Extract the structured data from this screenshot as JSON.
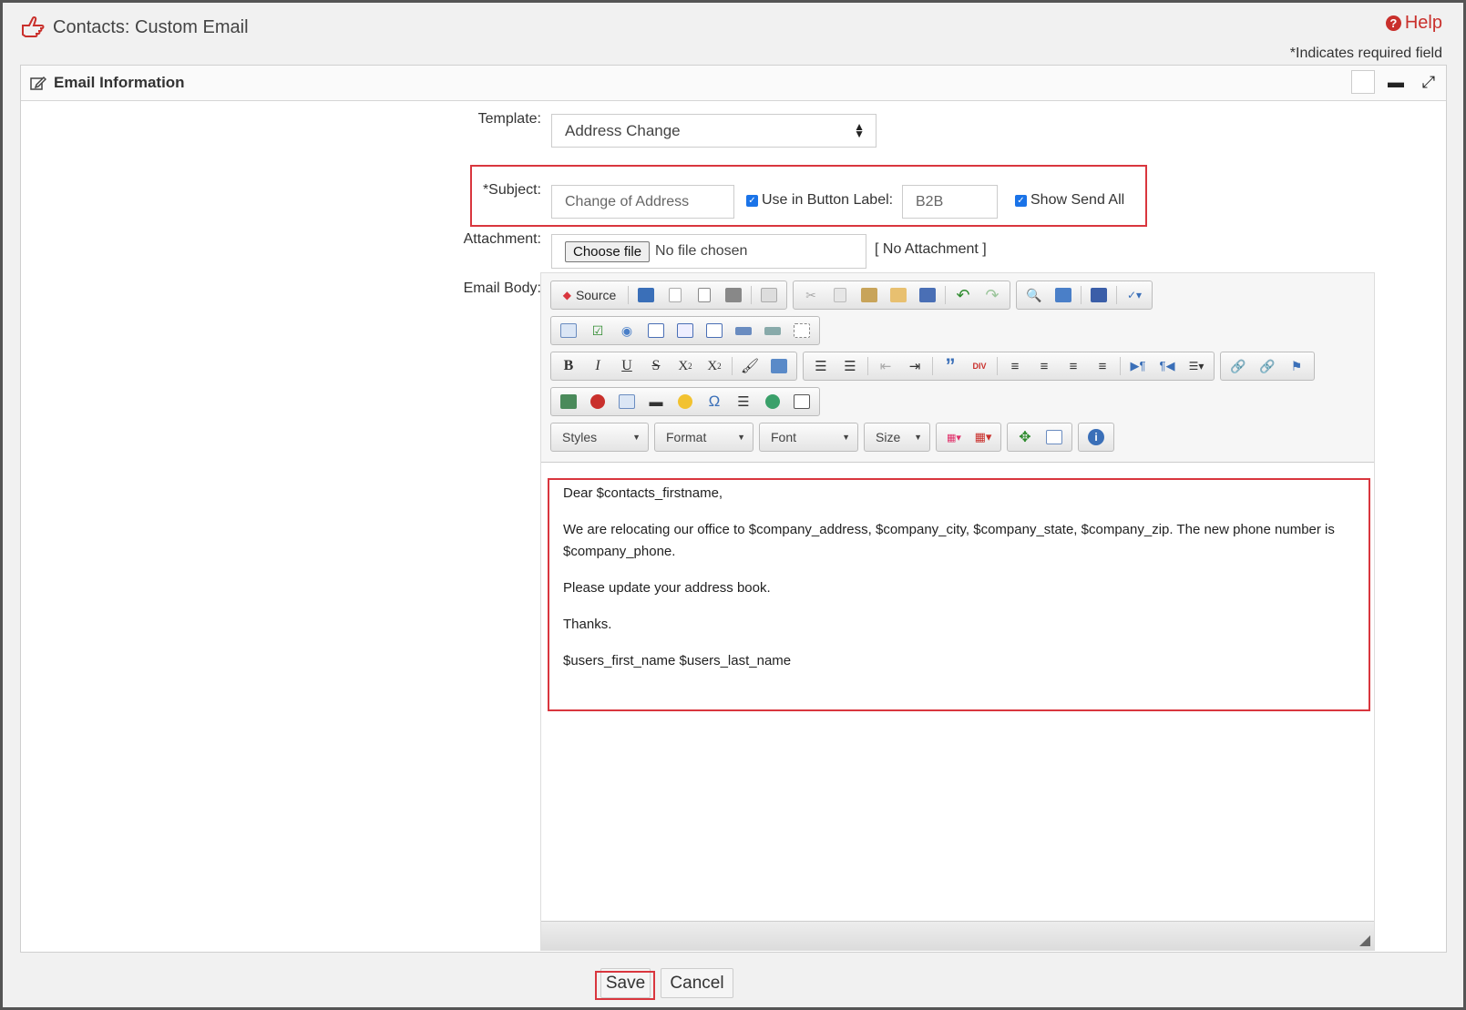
{
  "header": {
    "title": "Contacts: Custom Email",
    "help_label": "Help",
    "required_note": "*Indicates required field"
  },
  "panel": {
    "title": "Email Information"
  },
  "form": {
    "template_label": "Template:",
    "template_value": "Address Change",
    "subject_label": "*Subject:",
    "subject_value": "Change of Address",
    "use_in_button_label": "Use in Button Label:",
    "button_label_value": "B2B",
    "show_send_all_label": "Show Send All",
    "attachment_label": "Attachment:",
    "choose_file_label": "Choose file",
    "no_file_text": "No file chosen",
    "no_attachment_text": "[ No Attachment ]",
    "email_body_label": "Email Body:"
  },
  "editor": {
    "source_label": "Source",
    "combos": [
      "Styles",
      "Format",
      "Font",
      "Size"
    ],
    "body": [
      "Dear $contacts_firstname,",
      "We are relocating our office to $company_address, $company_city, $company_state, $company_zip. The new phone number is $company_phone.",
      "Please update your address book.",
      "Thanks.",
      "$users_first_name $users_last_name"
    ]
  },
  "footer": {
    "save_label": "Save",
    "cancel_label": "Cancel"
  },
  "colors": {
    "accent_red": "#d9363e",
    "help_red": "#c9302c",
    "checkbox_blue": "#1a73e8"
  }
}
